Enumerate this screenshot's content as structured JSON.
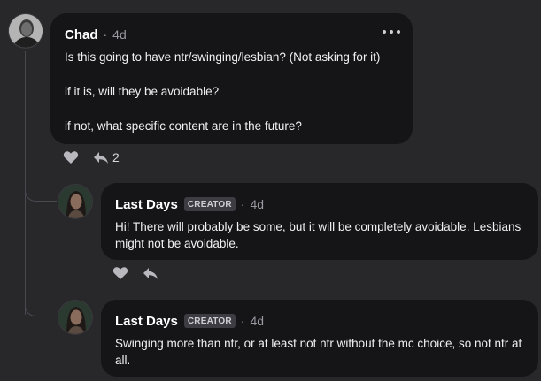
{
  "comments": [
    {
      "author": "Chad",
      "separator": "·",
      "time": "4d",
      "lines": [
        "Is this going to have ntr/swinging/lesbian? (Not asking for it)",
        "if it is, will they be avoidable?",
        "if not, what specific content are in the future?"
      ],
      "reply_count": "2"
    }
  ],
  "replies": [
    {
      "author": "Last Days",
      "badge": "CREATOR",
      "separator": "·",
      "time": "4d",
      "text": "Hi! There will probably be some, but it will be completely avoidable. Lesbians might not be avoidable."
    },
    {
      "author": "Last Days",
      "badge": "CREATOR",
      "separator": "·",
      "time": "4d",
      "text": "Swinging more than ntr, or at least not ntr without the mc choice, so not ntr at all."
    }
  ],
  "icons": {
    "more": "more-options-icon",
    "like": "heart-icon",
    "reply": "reply-icon"
  },
  "colors": {
    "background": "#28272a",
    "bubble": "#151417",
    "muted": "#9a99a0",
    "badge_bg": "#3d3c42"
  }
}
